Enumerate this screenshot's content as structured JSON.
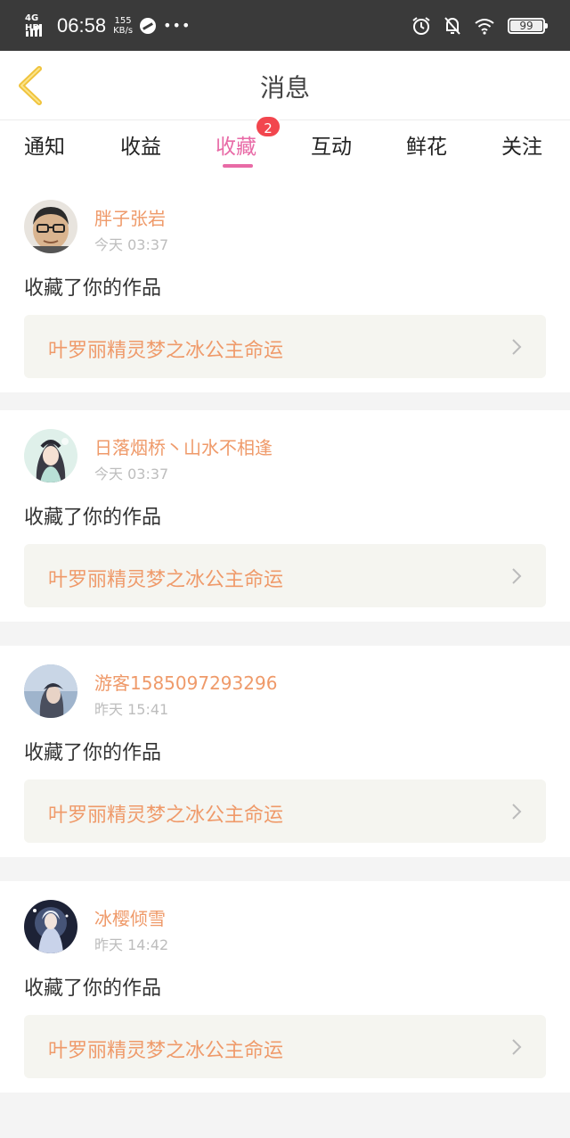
{
  "status_bar": {
    "network": "4G HD",
    "time": "06:58",
    "speed_value": "155",
    "speed_unit": "KB/s",
    "more": "•••",
    "battery": "99"
  },
  "header": {
    "title": "消息"
  },
  "tabs": [
    {
      "label": "通知",
      "active": false
    },
    {
      "label": "收益",
      "active": false
    },
    {
      "label": "收藏",
      "active": true,
      "badge": "2"
    },
    {
      "label": "互动",
      "active": false
    },
    {
      "label": "鲜花",
      "active": false
    },
    {
      "label": "关注",
      "active": false
    }
  ],
  "messages": [
    {
      "username": "胖子张岩",
      "time": "今天 03:37",
      "action": "收藏了你的作品",
      "work_title": "叶罗丽精灵梦之冰公主命运"
    },
    {
      "username": "日落烟桥丶山水不相逢",
      "time": "今天 03:37",
      "action": "收藏了你的作品",
      "work_title": "叶罗丽精灵梦之冰公主命运"
    },
    {
      "username": "游客1585097293296",
      "time": "昨天 15:41",
      "action": "收藏了你的作品",
      "work_title": "叶罗丽精灵梦之冰公主命运"
    },
    {
      "username": "冰樱倾雪",
      "time": "昨天 14:42",
      "action": "收藏了你的作品",
      "work_title": "叶罗丽精灵梦之冰公主命运"
    }
  ],
  "colors": {
    "accent_pink": "#e86aa6",
    "username_orange": "#ef9a6a",
    "badge_red": "#f2464e",
    "back_arrow_yellow": "#f0c33c"
  }
}
